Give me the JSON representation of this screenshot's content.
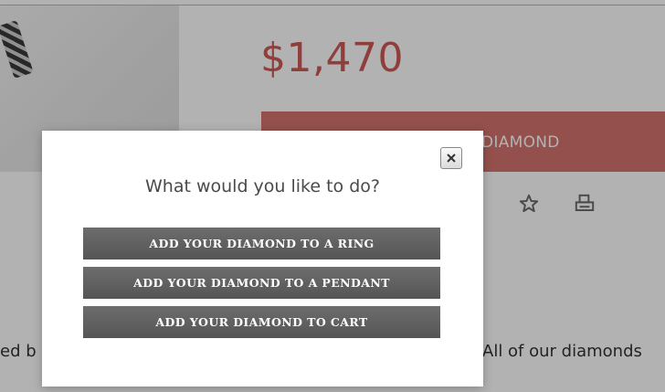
{
  "product": {
    "price": "$1,470",
    "cta_label": "DIAMOND",
    "bottom_left_text": "ed b",
    "bottom_right_text": "All of our diamonds"
  },
  "icons": {
    "star": "star-icon",
    "print": "print-icon",
    "close": "close-icon"
  },
  "modal": {
    "title": "What would you like to do?",
    "actions": [
      {
        "label": "ADD YOUR DIAMOND TO A RING"
      },
      {
        "label": "ADD YOUR DIAMOND TO A PENDANT"
      },
      {
        "label": "ADD YOUR DIAMOND TO CART"
      }
    ]
  },
  "colors": {
    "price": "#cf5a55",
    "cta": "#d4736e",
    "modal_button": "#606060",
    "overlay": "rgba(0,0,0,0.30)"
  }
}
